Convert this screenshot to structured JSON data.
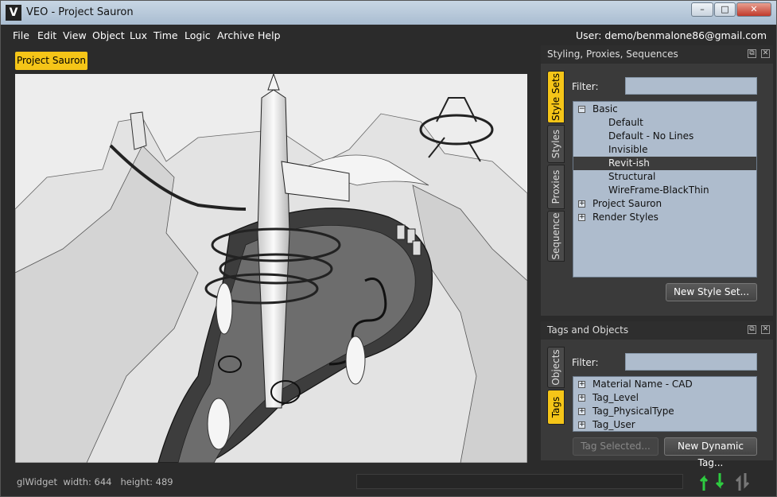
{
  "window": {
    "title": "VEO - Project Sauron",
    "logo_letter": "V",
    "minimize": "–",
    "maximize": "□",
    "close": "✕"
  },
  "menu": [
    "File",
    "Edit",
    "View",
    "Object",
    "Lux",
    "Time",
    "Logic",
    "Archive",
    "Help"
  ],
  "user_label": "User: demo/benmalone86@gmail.com",
  "viewport_tab": "Project Sauron",
  "status": {
    "widget": "glWidget",
    "width_label": "width: 644",
    "height_label": "height: 489"
  },
  "styling_panel": {
    "title": "Styling, Proxies, Sequences",
    "tabs": [
      "Style Sets",
      "Styles",
      "Proxies",
      "Sequence"
    ],
    "filter_label": "Filter:",
    "filter_value": "",
    "tree": [
      {
        "label": "Basic",
        "toggle": "−"
      },
      {
        "label": "Default"
      },
      {
        "label": "Default - No Lines"
      },
      {
        "label": "Invisible"
      },
      {
        "label": "Revit-ish",
        "selected": true
      },
      {
        "label": "Structural"
      },
      {
        "label": "WireFrame-BlackThin"
      },
      {
        "label": "Project Sauron",
        "toggle": "+"
      },
      {
        "label": "Render Styles",
        "toggle": "+"
      }
    ],
    "new_button": "New Style Set..."
  },
  "tags_panel": {
    "title": "Tags and Objects",
    "tabs": [
      "Objects",
      "Tags"
    ],
    "filter_label": "Filter:",
    "filter_value": "",
    "tree": [
      {
        "label": "Material Name - CAD",
        "toggle": "+"
      },
      {
        "label": "Tag_Level",
        "toggle": "+"
      },
      {
        "label": "Tag_PhysicalType",
        "toggle": "+"
      },
      {
        "label": "Tag_User",
        "toggle": "+"
      }
    ],
    "tag_selected_button": "Tag Selected...",
    "new_dynamic_button": "New Dynamic Tag..."
  },
  "colors": {
    "accent": "#f5c518",
    "panel": "#3a3a3a",
    "tree_bg": "#aebccd"
  }
}
